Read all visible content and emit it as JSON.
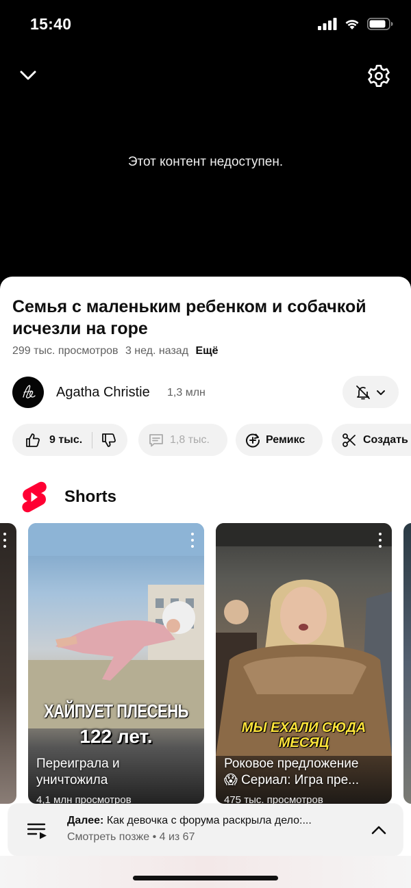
{
  "status": {
    "time": "15:40"
  },
  "player": {
    "message": "Этот контент недоступен."
  },
  "video": {
    "title": "Семья с маленьким ребенком и собачкой исчезли на горе",
    "views": "299 тыс. просмотров",
    "ago": "3 нед. назад",
    "more": "Ещё"
  },
  "channel": {
    "name": "Agatha Christie",
    "subscribers": "1,3 млн"
  },
  "actions": {
    "likes": "9 тыс.",
    "comments": "1,8 тыс.",
    "remix": "Ремикс",
    "create": "Создать"
  },
  "shorts": {
    "section_label": "Shorts",
    "items": [
      {
        "overlay_line1": "ХАЙПУЕТ ПЛЕСЕНЬ",
        "overlay_line2": "122 лет.",
        "title_line1": "Переиграла и",
        "title_line2": "уничтожила",
        "views": "4,1 млн просмотров"
      },
      {
        "overlay_line1": "МЫ ЕХАЛИ СЮДА",
        "overlay_line2": "МЕСЯЦ",
        "title_line1": "Роковое предложение",
        "title_line2": "😱 Сериал: Игра пре...",
        "views": "475 тыс. просмотров"
      }
    ]
  },
  "up_next": {
    "label": "Далее:",
    "title": "Как девочка с форума раскрыла дело:...",
    "playlist": "Смотреть позже • 4 из 67"
  },
  "colors": {
    "shorts_red": "#ff0033",
    "caption_yellow": "#ffe43b"
  }
}
